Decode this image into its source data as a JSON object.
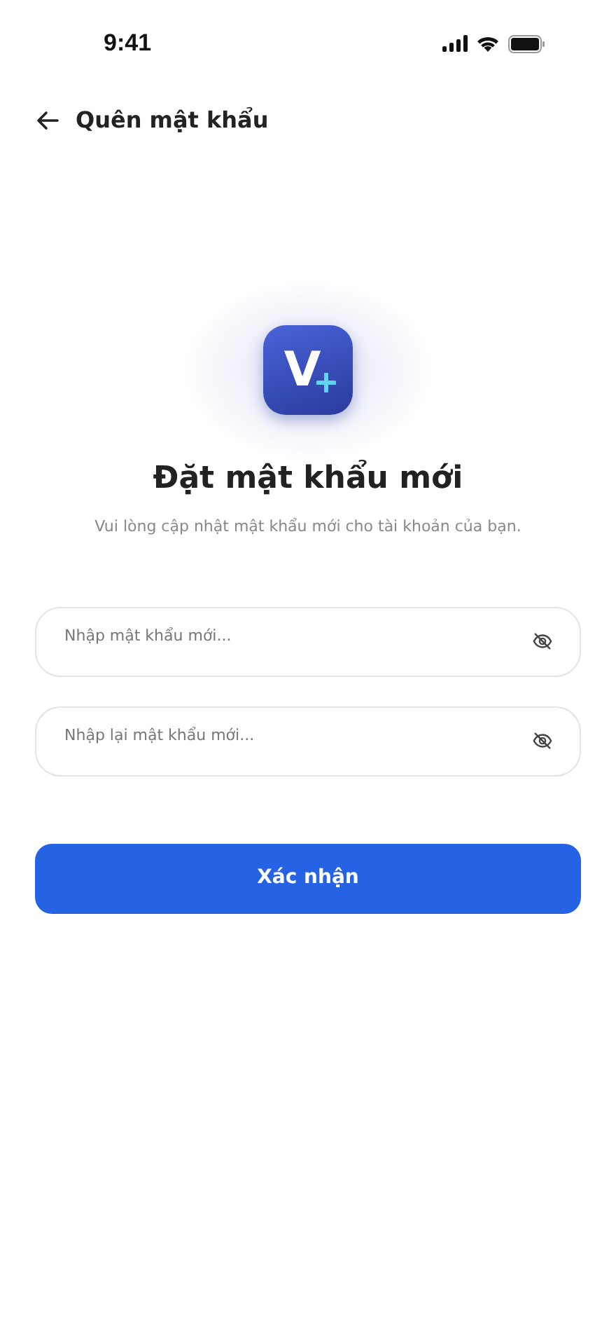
{
  "status_bar": {
    "time": "9:41"
  },
  "header": {
    "title": "Quên mật khẩu"
  },
  "logo": {
    "letter": "V"
  },
  "title": "Đặt mật khẩu mới",
  "subtitle": "Vui lòng cập nhật mật khẩu mới cho tài khoản của bạn.",
  "fields": [
    {
      "placeholder": "Nhập mật khẩu mới..."
    },
    {
      "placeholder": "Nhập lại mật khẩu mới..."
    }
  ],
  "submit": {
    "label": "Xác nhận"
  }
}
